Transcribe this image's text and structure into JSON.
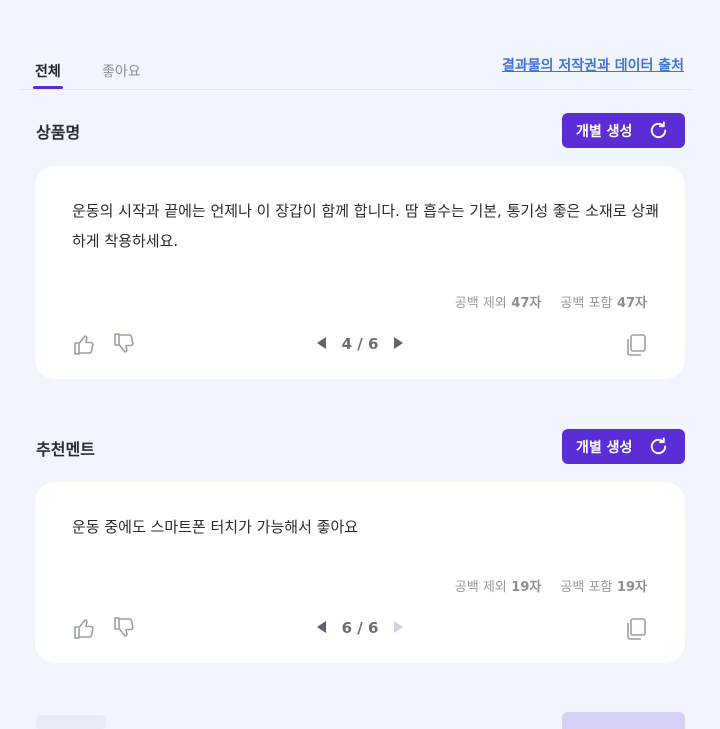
{
  "tabs": [
    {
      "label": "전체",
      "active": true
    },
    {
      "label": "좋아요",
      "active": false
    }
  ],
  "copyright_link": "결과물의 저작권과 데이터 출처",
  "accent_color": "#5a2dd6",
  "sections": [
    {
      "title": "상품명",
      "generate_label": "개별 생성",
      "text": "운동의 시작과 끝에는 언제나 이 장갑이 함께 합니다. 땀 흡수는 기본, 통기성 좋은 소재로 상쾌하게 착용하세요.",
      "count_without_space_label": "공백 제외",
      "count_without_space": "47자",
      "count_with_space_label": "공백 포함",
      "count_with_space": "47자",
      "pager": "4 / 6"
    },
    {
      "title": "추천멘트",
      "generate_label": "개별 생성",
      "text": "운동 중에도 스마트폰 터치가 가능해서 좋아요",
      "count_without_space_label": "공백 제외",
      "count_without_space": "19자",
      "count_with_space_label": "공백 포함",
      "count_with_space": "19자",
      "pager": "6 / 6"
    }
  ]
}
